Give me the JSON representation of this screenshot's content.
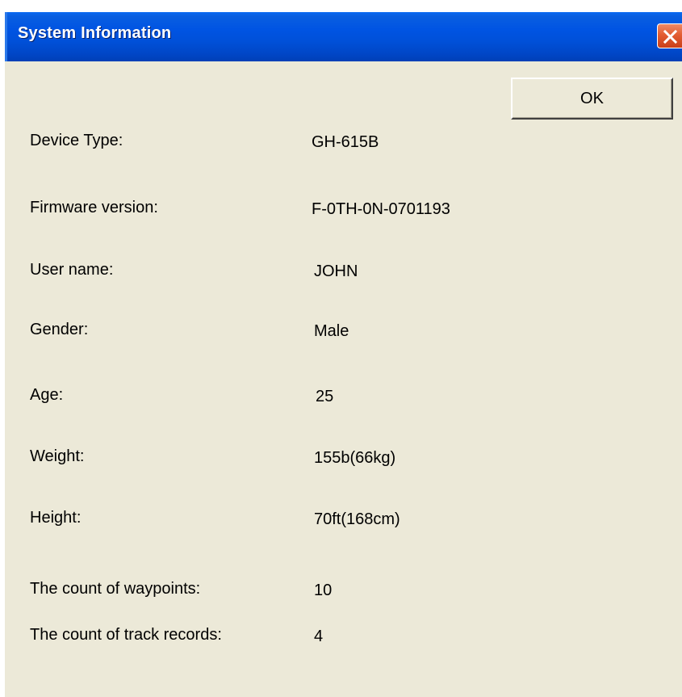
{
  "window": {
    "title": "System Information",
    "ok_label": "OK"
  },
  "fields": {
    "device_type": {
      "label": "Device Type:",
      "value": "GH-615B"
    },
    "firmware_version": {
      "label": "Firmware version:",
      "value": "F-0TH-0N-0701193"
    },
    "user_name": {
      "label": "User name:",
      "value": "JOHN"
    },
    "gender": {
      "label": "Gender:",
      "value": "Male"
    },
    "age": {
      "label": "Age:",
      "value": "25"
    },
    "weight": {
      "label": "Weight:",
      "value": "155b(66kg)"
    },
    "height": {
      "label": "Height:",
      "value": "70ft(168cm)"
    },
    "waypoints_count": {
      "label": "The count of waypoints:",
      "value": "10"
    },
    "track_records_count": {
      "label": "The count of track records:",
      "value": "4"
    }
  },
  "icons": {
    "close": "close-icon"
  },
  "colors": {
    "titlebar": "#0054e3",
    "dialog_background": "#ece9d8",
    "close_button": "#e35d32",
    "text": "#000000"
  }
}
